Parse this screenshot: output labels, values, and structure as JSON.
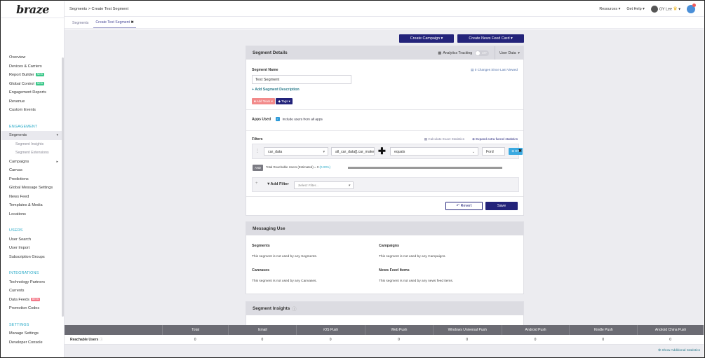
{
  "app": {
    "logo": "braze"
  },
  "topbar": {
    "breadcrumb": "Segments > Create Test Segment",
    "resources": "Resources",
    "get_help": "Get Help",
    "user": "OY Lee"
  },
  "tabs": [
    {
      "label": "Segments"
    },
    {
      "label": "Create Test Segment"
    }
  ],
  "sidebar": {
    "items_top": [
      "Overview",
      "Devices & Carriers",
      "Report Builder",
      "Global Control",
      "Engagement Reports",
      "Revenue",
      "Custom Events"
    ],
    "badges": {
      "new": "NEW",
      "beta": "BETA"
    },
    "section_engagement": "ENGAGEMENT",
    "items_engagement": [
      "Segments",
      "Segment Insights",
      "Segment Extensions",
      "Campaigns",
      "Canvas",
      "Predictions",
      "Global Message Settings",
      "News Feed",
      "Templates & Media",
      "Locations"
    ],
    "section_users": "USERS",
    "items_users": [
      "User Search",
      "User Import",
      "Subscription Groups"
    ],
    "section_integrations": "INTEGRATIONS",
    "items_integrations": [
      "Technology Partners",
      "Currents",
      "Data Feeds",
      "Promotion Codes"
    ],
    "section_settings": "SETTINGS",
    "items_settings": [
      "Manage Settings",
      "Developer Console"
    ]
  },
  "actions": {
    "create_campaign": "Create Campaign ▾",
    "create_news_feed": "Create News Feed Card ▾"
  },
  "segment_details": {
    "title": "Segment Details",
    "analytics_tracking": "Analytics Tracking",
    "toggle_state": "OFF",
    "user_data": "User Data",
    "segment_name_label": "Segment Name",
    "segment_name_value": "Test Segment",
    "changes_link": "0 Changes Since Last Viewed",
    "add_description": "+ Add Segment Description",
    "add_team": "Add Team",
    "tags": "Tags",
    "apps_used_label": "Apps Used",
    "include_all_apps": "Include users from all apps",
    "filters_label": "Filters",
    "calculate_exact": "Calculate Exact Statistics",
    "expand_funnel": "Expand extra funnel statistics",
    "filter": {
      "attribute": "car_data",
      "path": "all_car_data[].car_make",
      "operator": "equals",
      "value": "Ford",
      "or": "OR"
    },
    "and_label": "AND",
    "reachable_text": "Total Reachable Users (Estimated) = 0",
    "reachable_pct": "(0.00%)",
    "add_filter": "Add Filter",
    "select_filter_placeholder": "Select Filter...",
    "revert": "Revert",
    "save": "Save"
  },
  "messaging_use": {
    "title": "Messaging Use",
    "segments_title": "Segments",
    "segments_text": "This segment is not used by any Segments.",
    "campaigns_title": "Campaigns",
    "campaigns_text": "This segment is not used by any Campaigns.",
    "canvases_title": "Canvases",
    "canvases_text": "This segment is not used by any Canvases.",
    "newsfeed_title": "News Feed Items",
    "newsfeed_text": "This segment is not used by any news feed items."
  },
  "segment_insights": {
    "title": "Segment Insights"
  },
  "stats": {
    "headers": [
      "",
      "Total",
      "Email",
      "iOS Push",
      "Web Push",
      "Windows Universal Push",
      "Android Push",
      "Kindle Push",
      "Android China Push"
    ],
    "row_label": "Reachable Users",
    "values": [
      "0",
      "0",
      "0",
      "0",
      "0",
      "0",
      "0",
      "0"
    ],
    "show_more": "Show Additional Statistics"
  },
  "colors": {
    "primary": "#23237a",
    "accent": "#27a9c7",
    "header_gray": "#6b6b73"
  }
}
